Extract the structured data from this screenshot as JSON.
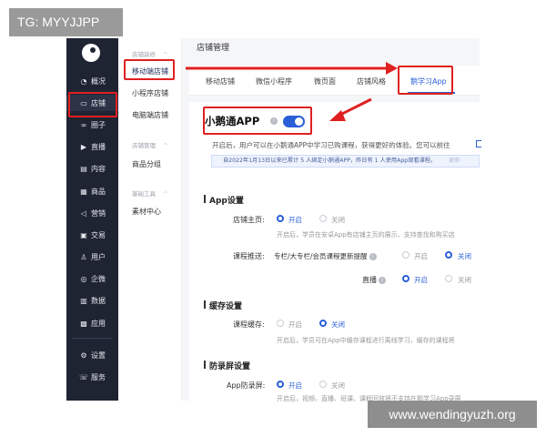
{
  "watermarks": {
    "top": "TG: MYYJJPP",
    "bottom": "www.wendingyuzh.org"
  },
  "sidebar": {
    "items": [
      {
        "icon": "chart-icon",
        "glyph": "◔",
        "label": "概况"
      },
      {
        "icon": "store-icon",
        "glyph": "▭",
        "label": "店铺"
      },
      {
        "icon": "circle-group-icon",
        "glyph": "∞",
        "label": "圈子"
      },
      {
        "icon": "live-icon",
        "glyph": "▶",
        "label": "直播"
      },
      {
        "icon": "content-icon",
        "glyph": "▤",
        "label": "内容"
      },
      {
        "icon": "goods-icon",
        "glyph": "▦",
        "label": "商品"
      },
      {
        "icon": "marketing-icon",
        "glyph": "◁",
        "label": "营销"
      },
      {
        "icon": "trade-icon",
        "glyph": "▣",
        "label": "交易"
      },
      {
        "icon": "user-icon",
        "glyph": "♙",
        "label": "用户"
      },
      {
        "icon": "wecom-icon",
        "glyph": "◎",
        "label": "企微"
      },
      {
        "icon": "data-icon",
        "glyph": "▥",
        "label": "数据"
      },
      {
        "icon": "apps-icon",
        "glyph": "▩",
        "label": "应用"
      },
      {
        "icon": "settings-icon",
        "glyph": "⚙",
        "label": "设置"
      },
      {
        "icon": "service-icon",
        "glyph": "☏",
        "label": "服务"
      }
    ]
  },
  "subbar": {
    "group1": "店铺装修",
    "item_mobile": "移动端店铺",
    "item_mini": "小程序店铺",
    "item_pc": "电脑端店铺",
    "group2": "店铺管理",
    "item_goods_group": "商品分组",
    "group3": "基础工具",
    "item_material": "素材中心",
    "caret": "^"
  },
  "main": {
    "page_title": "店铺管理",
    "tabs": [
      "移动店铺",
      "微信小程序",
      "微页面",
      "店铺风格",
      "鹅学习App"
    ],
    "app_title": "小鹅通APP",
    "info": "i",
    "toggle_on": true,
    "desc": "开启后，用户可以在小鹅通APP中学习已购课程，获得更好的体验。您可以前往",
    "notice": "自2022年1月13日以来已累计 5 人绑定小鹅通APP，昨日有 1 人使用App观看课程。",
    "notice_link": "更新",
    "sections": {
      "app_settings": "App设置",
      "cache": "缓存设置",
      "screenshot": "防录屏设置"
    },
    "store_home": {
      "label": "店铺主页:",
      "on": "开启",
      "off": "关闭",
      "hint": "开启后，学员在安卓App有店铺主页的展示、支持查找和购买店"
    },
    "course_push": {
      "label": "课程推送:",
      "text": "专栏/大专栏/会员课程更新提醒",
      "on": "开启",
      "off": "关闭"
    },
    "live": {
      "label": "直播",
      "on": "开启",
      "off": "关闭"
    },
    "course_cache": {
      "label": "课程缓存:",
      "on": "开启",
      "off": "关闭",
      "hint": "开启后，学员可在App中缓存课程进行离线学习，缓存的课程将"
    },
    "app_anti": {
      "label": "App防录屏:",
      "on": "开启",
      "off": "关闭",
      "hint": "开启后，视频、直播、班课、课程回放将不支持在鹅学习App录屏"
    }
  },
  "colors": {
    "accent": "#2a5fd8",
    "annotation": "#e02020",
    "sidebar_bg": "#1f2433"
  }
}
